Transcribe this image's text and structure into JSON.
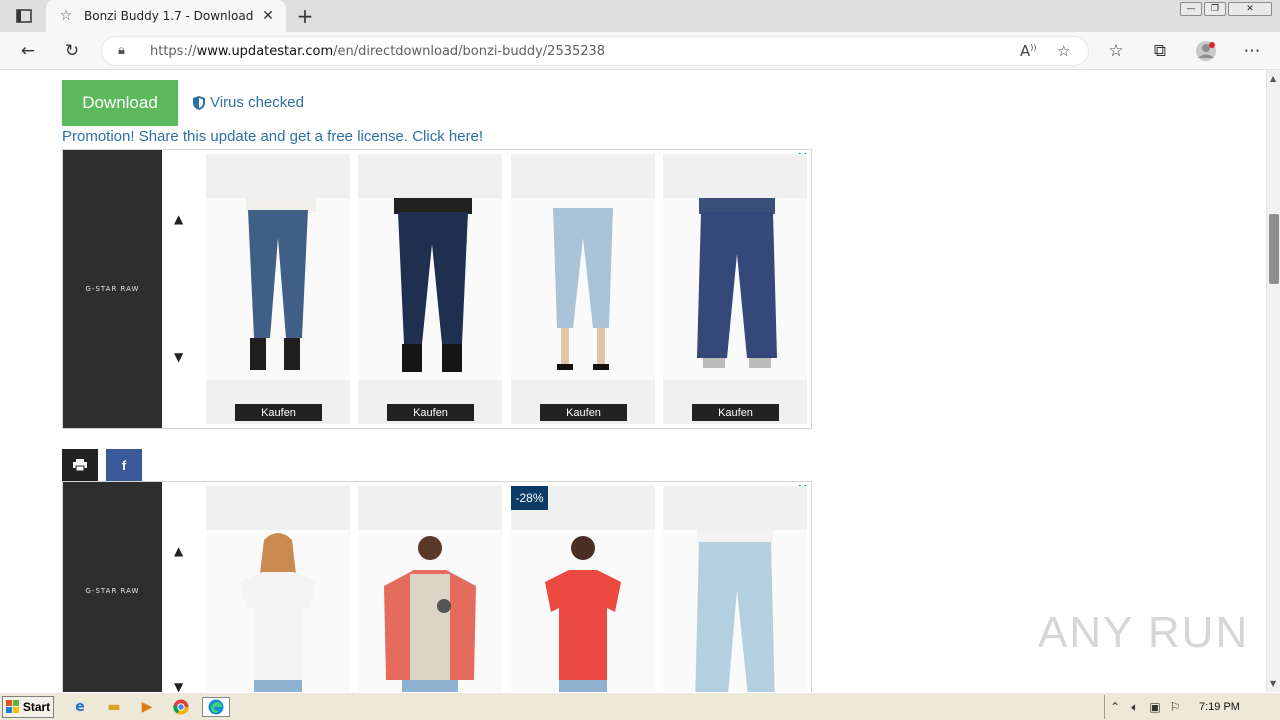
{
  "browser": {
    "tab_title": "Bonzi Buddy 1.7 - Download",
    "url_prefix": "https://",
    "url_domain": "www.updatestar.com",
    "url_path": "/en/directdownload/bonzi-buddy/2535238"
  },
  "page": {
    "download_label": "Download",
    "virus_label": "Virus checked",
    "promo_text": "Promotion! Share this update and get a free license. Click here!",
    "ad_brand": "G-STAR RAW",
    "ad1_products": [
      {
        "buy": "Kaufen"
      },
      {
        "buy": "Kaufen"
      },
      {
        "buy": "Kaufen"
      },
      {
        "buy": "Kaufen"
      }
    ],
    "ad2_discount": "-28%",
    "share_facebook": "f"
  },
  "watermark": "ANY RUN",
  "taskbar": {
    "start_label": "Start",
    "clock": "7:19 PM"
  },
  "colors": {
    "download_green": "#5cb85c",
    "link_blue": "#2f6fa5",
    "facebook_blue": "#3b5998",
    "discount_navy": "#0d3b66"
  }
}
